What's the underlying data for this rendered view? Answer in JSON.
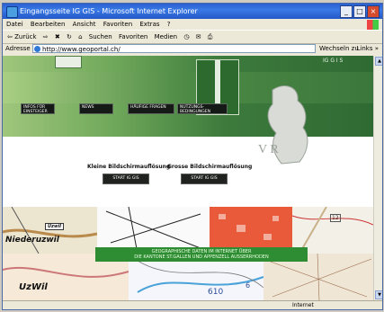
{
  "window": {
    "title": "Eingangsseite IG GIS - Microsoft Internet Explorer",
    "buttons": [
      "_",
      "□",
      "×"
    ]
  },
  "menu": {
    "items": [
      "Datei",
      "Bearbeiten",
      "Ansicht",
      "Favoriten",
      "Extras",
      "?"
    ]
  },
  "toolbar": {
    "back": "⇦ Zurück",
    "forward": "⇨",
    "search": "Suchen",
    "favorites": "Favoriten",
    "media": "Medien"
  },
  "address": {
    "label": "Adresse",
    "url": "http://www.geoportal.ch/",
    "go": "Wechseln zu",
    "links": "Links »"
  },
  "page": {
    "nav": [
      "INFOS FÜR EINSTEIGER",
      "NEWS",
      "HÄUFIGE FRAGEN",
      "NUTZUNGS-BEDINGUNGEN"
    ],
    "igs_label": "IG G I S",
    "crest_letters": "V R",
    "small_heading": "Kleine Bildschirmauflösung",
    "large_heading": "Grosse Bildschirmauflösung",
    "start_small": "START IG GIS",
    "start_large": "START IG GIS",
    "map_labels": {
      "uzwil_box": "Uzwil",
      "niederuzwil": "Niederuzwil",
      "uzwil": "UzWil",
      "number_610": "610",
      "number_6": "6",
      "number_12": "12"
    },
    "geo_banner_line1": "GEOGRAPHISCHE DATEN IM INTERNET ÜBER",
    "geo_banner_line2": "DIE KANTONE ST.GALLEN UND APPENZELL AUSSERRHODEN"
  },
  "status": {
    "zone": "Internet"
  }
}
